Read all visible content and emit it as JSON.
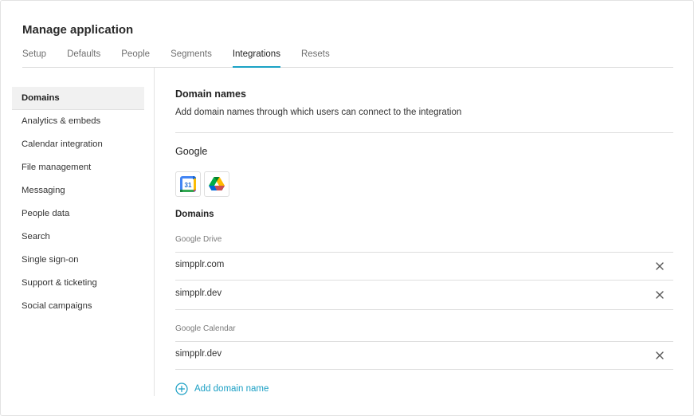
{
  "page": {
    "title": "Manage application"
  },
  "tabs": [
    {
      "label": "Setup",
      "active": false
    },
    {
      "label": "Defaults",
      "active": false
    },
    {
      "label": "People",
      "active": false
    },
    {
      "label": "Segments",
      "active": false
    },
    {
      "label": "Integrations",
      "active": true
    },
    {
      "label": "Resets",
      "active": false
    }
  ],
  "sidebar": {
    "items": [
      {
        "label": "Domains",
        "active": true
      },
      {
        "label": "Analytics & embeds"
      },
      {
        "label": "Calendar integration"
      },
      {
        "label": "File management"
      },
      {
        "label": "Messaging"
      },
      {
        "label": "People data"
      },
      {
        "label": "Search"
      },
      {
        "label": "Single sign-on"
      },
      {
        "label": "Support & ticketing"
      },
      {
        "label": "Social campaigns"
      }
    ]
  },
  "content": {
    "section_title": "Domain names",
    "section_description": "Add domain names through which users can connect to the integration",
    "provider": "Google",
    "app_icons": [
      {
        "icon": "google-calendar-icon",
        "text": "31"
      },
      {
        "icon": "google-drive-icon"
      }
    ],
    "domains_label": "Domains",
    "groups": [
      {
        "label": "Google Drive",
        "domains": [
          "simpplr.com",
          "simpplr.dev"
        ]
      },
      {
        "label": "Google Calendar",
        "domains": [
          "simpplr.dev"
        ]
      }
    ],
    "add_label": "Add domain name"
  },
  "colors": {
    "accent": "#1aa2c5",
    "link": "#1a9fc4"
  }
}
